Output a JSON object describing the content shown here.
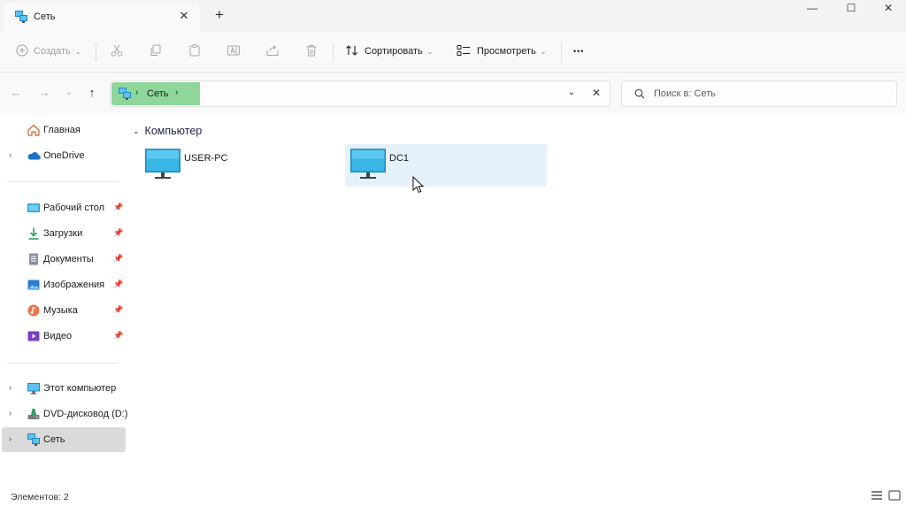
{
  "tab": {
    "title": "Сеть",
    "close_glyph": "✕",
    "new_glyph": "+"
  },
  "window": {
    "minimize_glyph": "—",
    "maximize_glyph": "☐",
    "close_glyph": "✕"
  },
  "toolbar": {
    "new_label": "Создать",
    "sort_label": "Сортировать",
    "view_label": "Просмотреть",
    "more_glyph": "•••"
  },
  "address": {
    "location": "Сеть",
    "separator": "›",
    "dropdown_glyph": "⌄",
    "clear_glyph": "✕"
  },
  "search": {
    "placeholder": "Поиск в: Сеть"
  },
  "sidebar": {
    "items": [
      {
        "label": "Главная",
        "icon": "home-icon"
      },
      {
        "label": "OneDrive",
        "icon": "onedrive-icon"
      },
      {
        "label": "Рабочий стол",
        "icon": "desktop-folder-icon",
        "pinned": true
      },
      {
        "label": "Загрузки",
        "icon": "downloads-icon",
        "pinned": true
      },
      {
        "label": "Документы",
        "icon": "documents-icon",
        "pinned": true
      },
      {
        "label": "Изображения",
        "icon": "pictures-icon",
        "pinned": true
      },
      {
        "label": "Музыка",
        "icon": "music-icon",
        "pinned": true
      },
      {
        "label": "Видео",
        "icon": "videos-icon",
        "pinned": true
      },
      {
        "label": "Этот компьютер",
        "icon": "this-pc-icon"
      },
      {
        "label": "DVD-дисковод (D:)",
        "icon": "dvd-drive-icon"
      },
      {
        "label": "Сеть",
        "icon": "network-icon",
        "selected": true
      }
    ]
  },
  "content": {
    "group_title": "Компьютер",
    "items": [
      {
        "label": "USER-PC",
        "icon": "computer-icon"
      },
      {
        "label": "DC1",
        "icon": "computer-icon",
        "hovered": true
      }
    ]
  },
  "status": {
    "items_count": "Элементов: 2"
  },
  "colors": {
    "accent": "#0078d4",
    "breadcrumb_highlight": "#8fd69a",
    "hover": "#e5f1fb",
    "selected_nav": "#dadada"
  }
}
